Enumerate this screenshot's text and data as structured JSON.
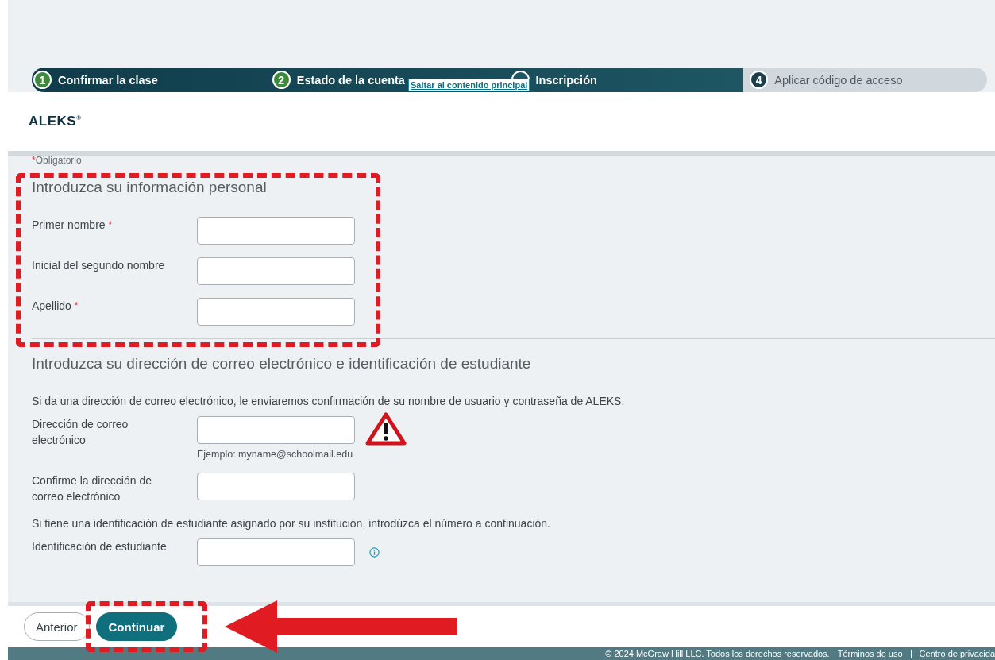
{
  "steps": [
    {
      "number": "1",
      "label": "Confirmar la clase",
      "kind": "done"
    },
    {
      "number": "2",
      "label": "Estado de la cuenta",
      "kind": "done"
    },
    {
      "label": "Inscripción",
      "kind": "current"
    },
    {
      "number": "4",
      "label": "Aplicar código de acceso",
      "kind": "todo"
    }
  ],
  "skip_link": "Saltar al contenido principal",
  "logo": "ALEKS",
  "logo_mark": "®",
  "required_note": {
    "mark": "*",
    "text": "Obligatorio"
  },
  "sections": [
    {
      "heading": "Introduzca su información personal",
      "items": [
        {
          "kind": "field",
          "label": "Primer nombre",
          "required": true
        },
        {
          "kind": "field",
          "label": "Inicial del segundo nombre",
          "required": false
        },
        {
          "kind": "field",
          "label": "Apellido",
          "required": true
        }
      ]
    },
    {
      "heading": "Introduzca su dirección de correo electrónico e identificación de estudiante",
      "items": [
        {
          "kind": "text",
          "text": "Si da una dirección de correo electrónico, le enviaremos confirmación de su nombre de usuario y contraseña de ALEKS."
        },
        {
          "kind": "field",
          "label": "Dirección de correo electrónico",
          "required": false,
          "hint": "Ejemplo: myname@schoolmail.edu",
          "alert": true
        },
        {
          "kind": "field",
          "label": "Confirme la dirección de correo electrónico",
          "required": false
        },
        {
          "kind": "text",
          "text": "Si tiene una identificación de estudiante asignado por su institución, introdúzca el número a continuación."
        },
        {
          "kind": "field",
          "label": "Identificación de estudiante",
          "required": false,
          "help": true
        }
      ]
    }
  ],
  "buttons": [
    {
      "label": "Anterior",
      "kind": "secondary"
    },
    {
      "label": "Continuar",
      "kind": "primary"
    }
  ],
  "footer": {
    "copyright": "© 2024 McGraw Hill LLC. Todos los derechos reservados.",
    "links": [
      "Términos de uso",
      "Centro de privacida"
    ]
  },
  "annotations": [
    {
      "kind": "frame"
    },
    {
      "kind": "frame"
    },
    {
      "kind": "arrow"
    }
  ]
}
